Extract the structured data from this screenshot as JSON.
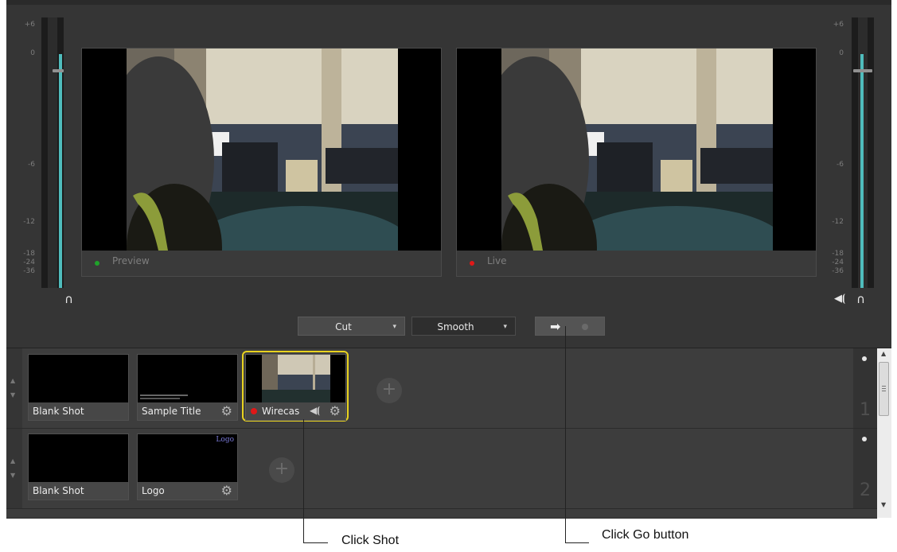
{
  "meters": {
    "left_scale": [
      "+6",
      "0",
      "-6",
      "-12",
      "-18",
      "-24",
      "-36"
    ],
    "right_scale": [
      "+6",
      "0",
      "-6",
      "-12",
      "-18",
      "-24",
      "-36"
    ]
  },
  "monitors": {
    "preview": {
      "label": "Preview",
      "dot_color": "#1fa32a"
    },
    "live": {
      "label": "Live",
      "dot_color": "#e01818"
    }
  },
  "transition": {
    "cut_label": "Cut",
    "smooth_label": "Smooth",
    "go_glyph": "➡"
  },
  "layers": [
    {
      "number": "1",
      "shots": [
        {
          "name": "Blank Shot"
        },
        {
          "name": "Sample Title"
        },
        {
          "name": "Wirecas"
        }
      ]
    },
    {
      "number": "2",
      "shots": [
        {
          "name": "Blank Shot"
        },
        {
          "name": "Logo",
          "thumb_text": "Logo"
        }
      ]
    }
  ],
  "annotations": {
    "click_shot": "Click Shot",
    "click_go": "Click Go button"
  },
  "colors": {
    "selected_outline": "#e8d21f",
    "meter_fill": "#4fbcbc"
  }
}
